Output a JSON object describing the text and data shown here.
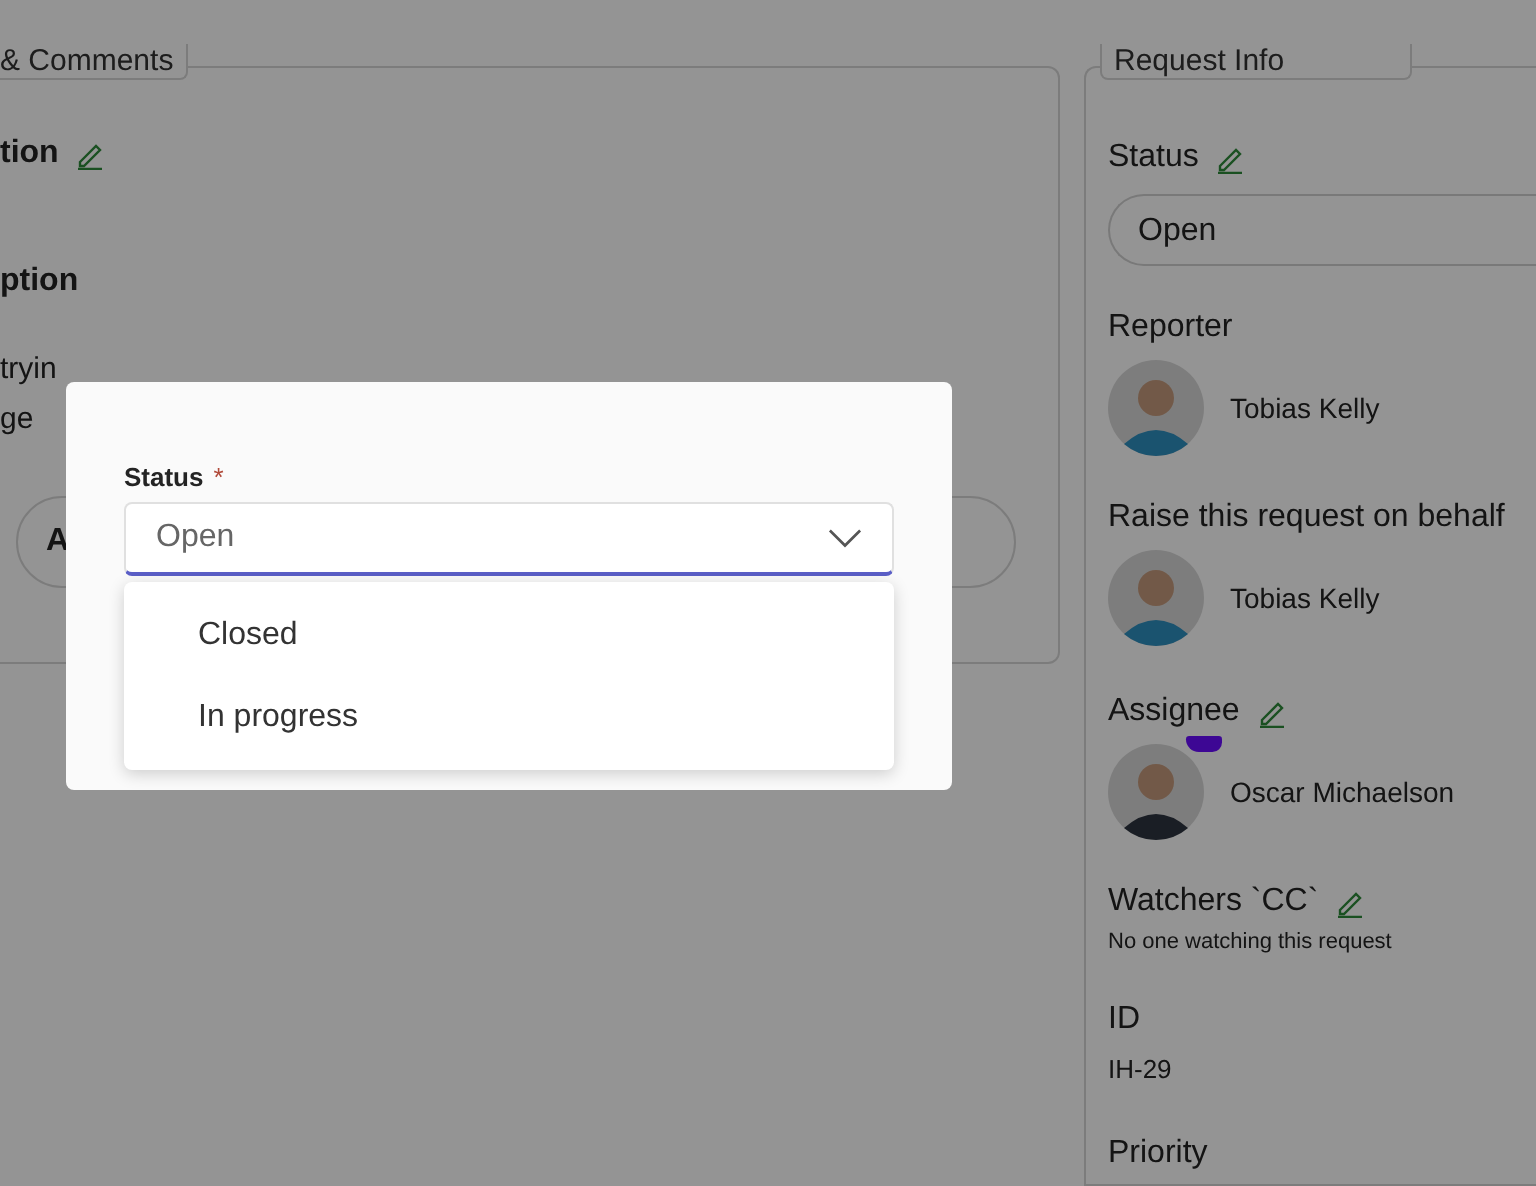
{
  "details_panel": {
    "legend": "& Comments",
    "section_title": "tion",
    "description_label": "ption",
    "description_lines": [
      "tryin",
      "ge"
    ],
    "comment_field_text": "A"
  },
  "request_info": {
    "legend": "Request Info",
    "status": {
      "label": "Status",
      "value": "Open"
    },
    "people": [
      {
        "label": "Reporter",
        "name": "Tobias Kelly",
        "editable": false
      },
      {
        "label": "Raise this request on behalf",
        "name": "Tobias Kelly",
        "editable": false
      },
      {
        "label": "Assignee",
        "name": "Oscar Michaelson",
        "editable": true
      }
    ],
    "watchers": {
      "label": "Watchers `CC`",
      "note": "No one watching this request"
    },
    "id": {
      "label": "ID",
      "value": "IH-29"
    },
    "priority": {
      "label": "Priority"
    }
  },
  "dialog": {
    "field_label": "Status",
    "required_mark": "*",
    "value": "Open",
    "options": [
      {
        "label": "Closed",
        "selected": false
      },
      {
        "label": "In progress",
        "selected": false
      }
    ]
  }
}
